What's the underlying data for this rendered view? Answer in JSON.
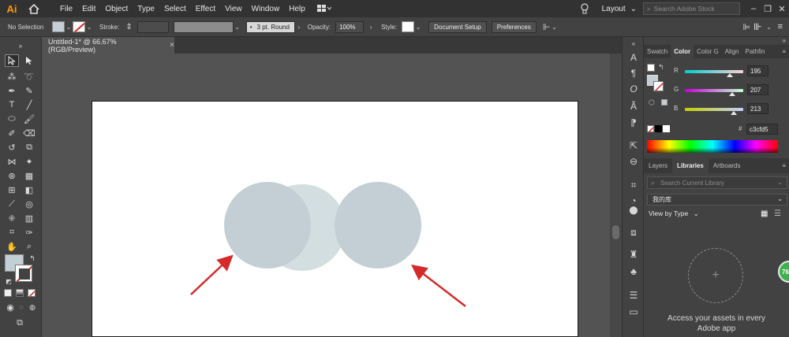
{
  "app": {
    "logo": "Ai"
  },
  "menu": [
    "File",
    "Edit",
    "Object",
    "Type",
    "Select",
    "Effect",
    "View",
    "Window",
    "Help"
  ],
  "header": {
    "layout_label": "Layout",
    "stock_placeholder": "Search Adobe Stock"
  },
  "control": {
    "selection": "No Selection",
    "stroke_label": "Stroke:",
    "brush": "3 pt. Round",
    "opacity_label": "Opacity:",
    "opacity_value": "100%",
    "style_label": "Style:",
    "document_setup": "Document Setup",
    "preferences": "Preferences"
  },
  "document": {
    "tab_title": "Untitled-1* @ 66.67% (RGB/Preview)",
    "close": "×"
  },
  "color_panel": {
    "tabs": [
      "Swatch",
      "Color",
      "Color G",
      "Align",
      "Pathfin"
    ],
    "active_tab": "Color",
    "channels": [
      {
        "letter": "R",
        "value": "195",
        "level": 0.765
      },
      {
        "letter": "G",
        "value": "207",
        "level": 0.812
      },
      {
        "letter": "B",
        "value": "213",
        "level": 0.835
      }
    ],
    "hex_label": "#",
    "hex_value": "c3cfd5",
    "fill_color": "#c3cfd5"
  },
  "libraries_panel": {
    "tabs": [
      "Layers",
      "Libraries",
      "Artboards"
    ],
    "active_tab": "Libraries",
    "search_placeholder": "Search Current Library",
    "library_name": "我的库",
    "view_by": "View by Type",
    "add_symbol": "+",
    "assets_line1": "Access your assets in every",
    "assets_line2": "Adobe app"
  },
  "badge": "76",
  "artwork": {
    "circle_left_color": "#c3cfd5",
    "circle_middle_color": "#d3dee1",
    "circle_right_color": "#c3cfd5",
    "arrow_color": "#d42a2a"
  }
}
